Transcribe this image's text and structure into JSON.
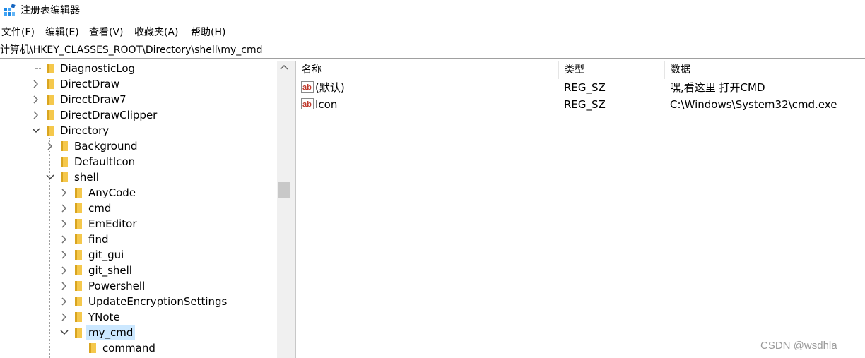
{
  "window": {
    "title": "注册表编辑器"
  },
  "menu": [
    "文件(F)",
    "编辑(E)",
    "查看(V)",
    "收藏夹(A)",
    "帮助(H)"
  ],
  "address": {
    "path": "计算机\\HKEY_CLASSES_ROOT\\Directory\\shell\\my_cmd"
  },
  "tree": {
    "items": [
      {
        "label": "DiagnosticLog",
        "level": 0,
        "expander": "none"
      },
      {
        "label": "DirectDraw",
        "level": 0,
        "expander": "collapsed"
      },
      {
        "label": "DirectDraw7",
        "level": 0,
        "expander": "collapsed"
      },
      {
        "label": "DirectDrawClipper",
        "level": 0,
        "expander": "collapsed"
      },
      {
        "label": "Directory",
        "level": 0,
        "expander": "expanded"
      },
      {
        "label": "Background",
        "level": 1,
        "expander": "collapsed"
      },
      {
        "label": "DefaultIcon",
        "level": 1,
        "expander": "none"
      },
      {
        "label": "shell",
        "level": 1,
        "expander": "expanded"
      },
      {
        "label": "AnyCode",
        "level": 2,
        "expander": "collapsed"
      },
      {
        "label": "cmd",
        "level": 2,
        "expander": "collapsed"
      },
      {
        "label": "EmEditor",
        "level": 2,
        "expander": "collapsed"
      },
      {
        "label": "find",
        "level": 2,
        "expander": "collapsed"
      },
      {
        "label": "git_gui",
        "level": 2,
        "expander": "collapsed"
      },
      {
        "label": "git_shell",
        "level": 2,
        "expander": "collapsed"
      },
      {
        "label": "Powershell",
        "level": 2,
        "expander": "collapsed"
      },
      {
        "label": "UpdateEncryptionSettings",
        "level": 2,
        "expander": "collapsed"
      },
      {
        "label": "YNote",
        "level": 2,
        "expander": "collapsed"
      },
      {
        "label": "my_cmd",
        "level": 2,
        "expander": "expanded",
        "selected": true
      },
      {
        "label": "command",
        "level": 3,
        "expander": "none"
      }
    ]
  },
  "list": {
    "columns": [
      "名称",
      "类型",
      "数据"
    ],
    "rows": [
      {
        "name": "(默认)",
        "type": "REG_SZ",
        "data": "嘿,看这里 打开CMD",
        "icon": "reg-string-icon"
      },
      {
        "name": "Icon",
        "type": "REG_SZ",
        "data": "C:\\Windows\\System32\\cmd.exe",
        "icon": "reg-string-icon"
      }
    ]
  },
  "watermark": "CSDN @wsdhla",
  "colors": {
    "selection": "#cce8ff",
    "folder": "#f5c84c",
    "reg_icon_red": "#c0392b"
  }
}
